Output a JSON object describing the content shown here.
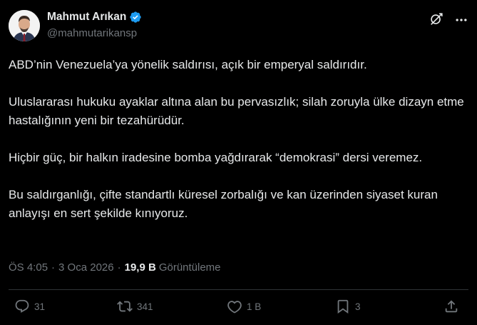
{
  "author": {
    "display_name": "Mahmut Arıkan",
    "handle": "@mahmutarikansp",
    "verified": true
  },
  "tweet": {
    "paragraphs": [
      "ABD’nin Venezuela’ya yönelik saldırısı, açık bir emperyal saldırıdır.",
      "Uluslararası hukuku ayaklar altına alan bu pervasızlık; silah zoruyla ülke dizayn etme hastalığının yeni bir tezahürüdür.",
      "Hiçbir güç, bir halkın iradesine bomba yağdırarak “demokrasi” dersi veremez.",
      "Bu saldırganlığı, çifte standartlı küresel zorbalığı ve kan üzerinden siyaset kuran anlayışı en sert şekilde kınıyoruz."
    ]
  },
  "meta": {
    "time": "ÖS 4:05",
    "separator": "·",
    "date": "3 Oca 2026",
    "views_count": "19,9 B",
    "views_label": "Görüntüleme"
  },
  "actions": {
    "replies": "31",
    "reposts": "341",
    "likes": "1 B",
    "bookmarks": "3"
  },
  "colors": {
    "background": "#000000",
    "text": "#e7e9ea",
    "secondary": "#71767b",
    "verified": "#1d9bf0",
    "divider": "#2f3336"
  },
  "icons": [
    "verified-badge-icon",
    "grok-icon",
    "more-icon",
    "reply-icon",
    "repost-icon",
    "like-icon",
    "bookmark-icon",
    "share-icon"
  ]
}
